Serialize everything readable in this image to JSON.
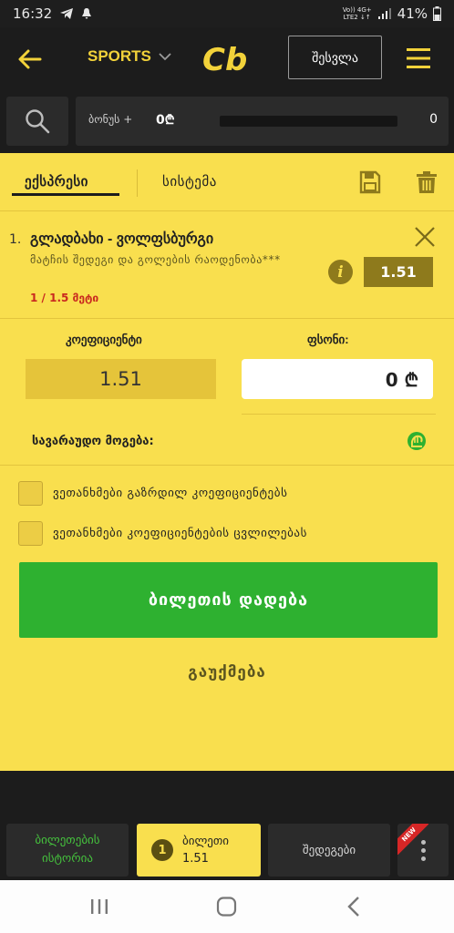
{
  "status_bar": {
    "time": "16:32",
    "network_top": "Vo)) 4G+",
    "network_bottom": "LTE2 ↓↑",
    "battery": "41%"
  },
  "header": {
    "sports_label": "SPORTS",
    "logo_text": "Cb",
    "login_label": "შესვლა"
  },
  "bonus": {
    "label": "ბონუს +",
    "value": "0₾",
    "count": "0",
    "progress_fraction": 0
  },
  "tabs": {
    "express": "ექსპრესი",
    "system": "სისტემა"
  },
  "bet": {
    "index": "1.",
    "match": "გლადბახი - ვოლფსბურგი",
    "market": "მატჩის შედეგი და გოლების რაოდენობა***",
    "selection": "1 / 1.5 მეტი",
    "info": "i",
    "odds": "1.51"
  },
  "stake": {
    "coef_label": "კოეფიციენტი",
    "coef_value": "1.51",
    "stake_label": "ფსონი:",
    "stake_value": "0 ₾",
    "potential_label": "სავარაუდო მოგება:"
  },
  "options": {
    "accept_increased": "ვეთანხმები გაზრდილ კოეფიციენტებს",
    "accept_changes": "ვეთანხმები კოეფიციენტების ცვლილებას"
  },
  "actions": {
    "place_bet": "ბილეთის დადება",
    "cancel": "გაუქმება"
  },
  "bottom_nav": {
    "history_line1": "ბილეთების",
    "history_line2": "ისტორია",
    "slip_count": "1",
    "slip_label": "ბილეთი",
    "slip_odds": "1.51",
    "results": "შედეგები",
    "new_badge": "NEW"
  },
  "colors": {
    "accent": "#f9df4e",
    "dark": "#1c1c1c",
    "green": "#2eb130",
    "red": "#c9291f"
  }
}
